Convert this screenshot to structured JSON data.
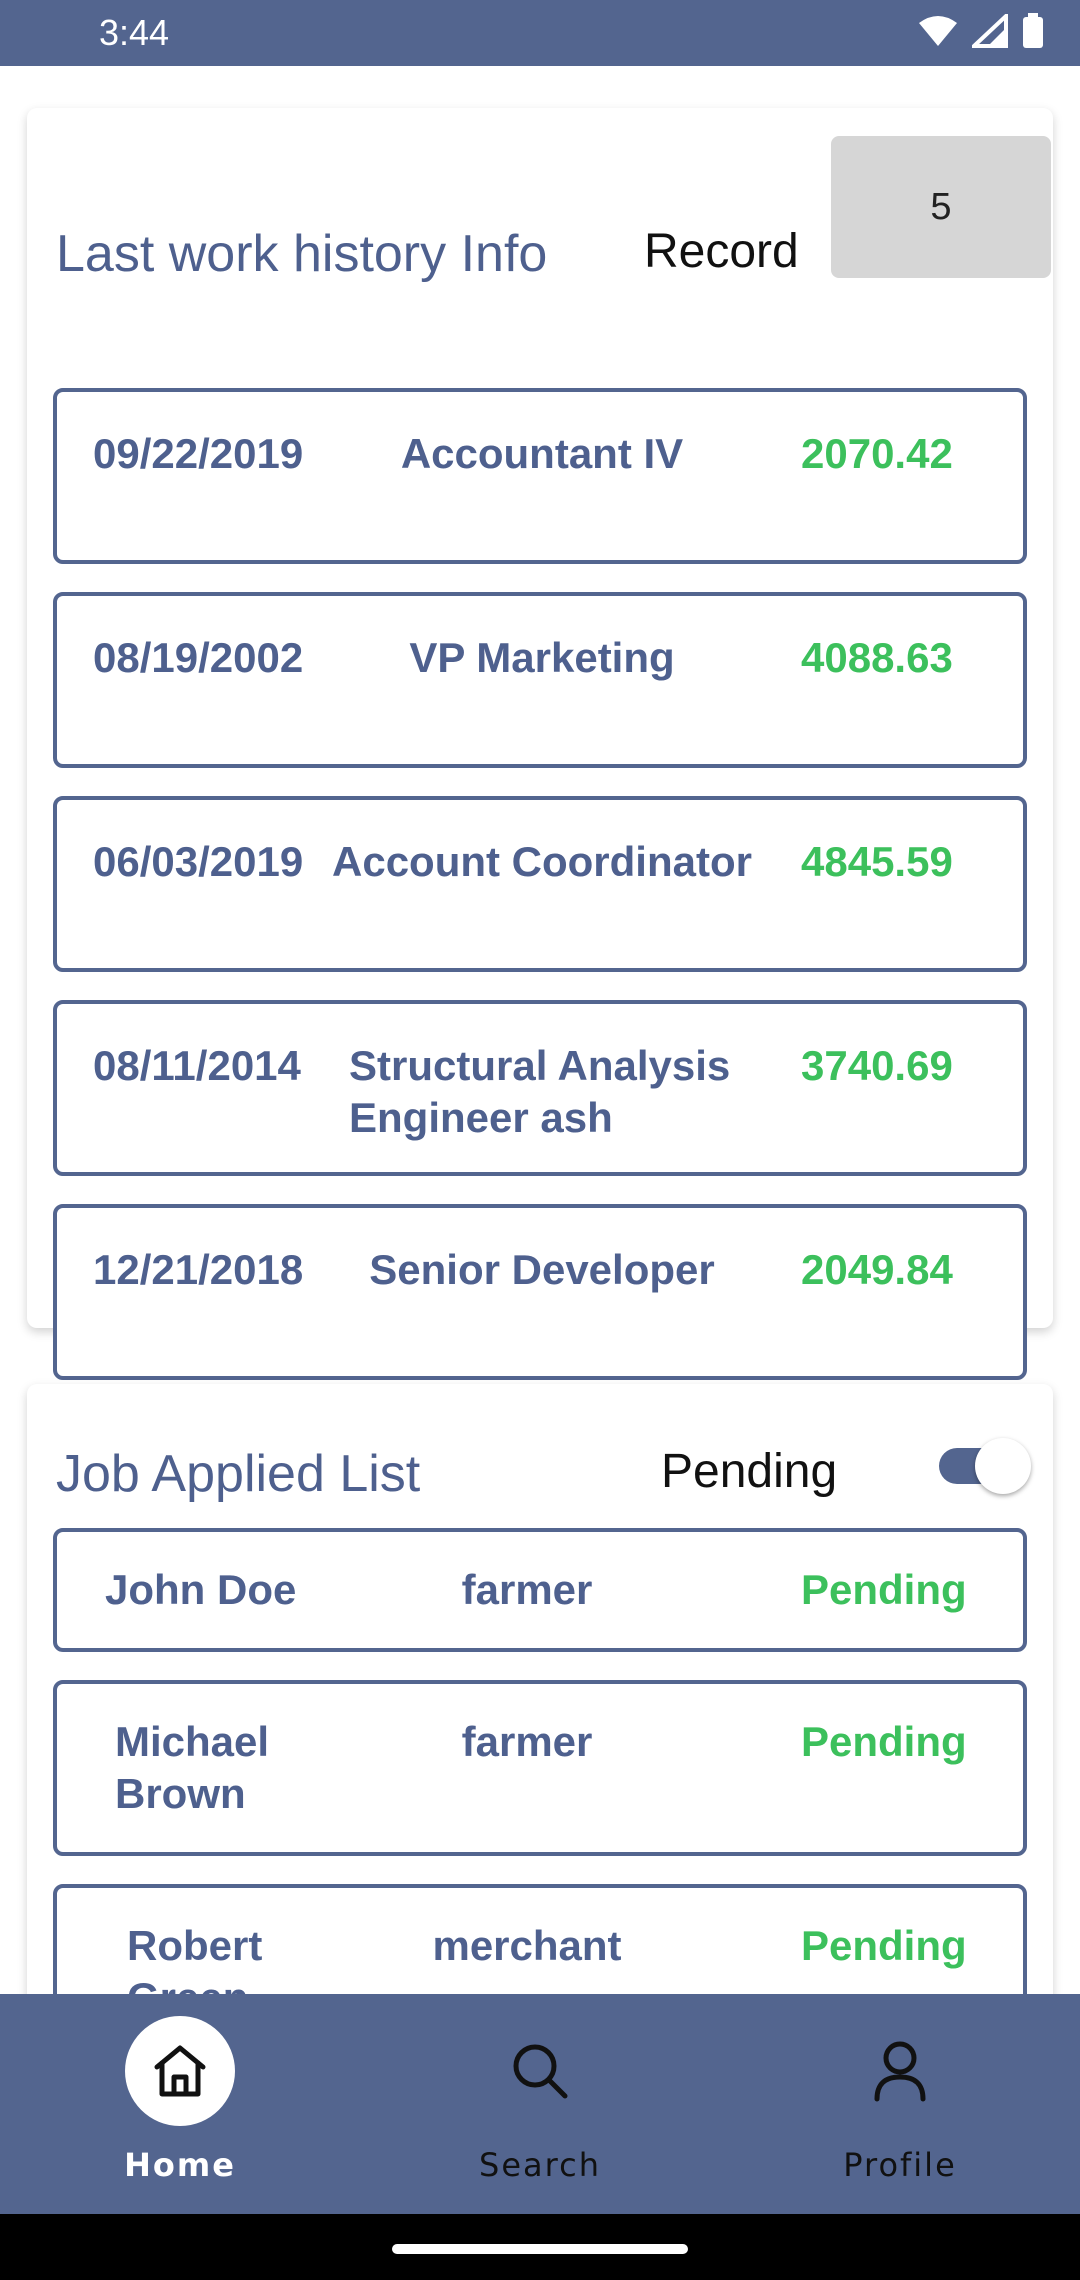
{
  "status_bar": {
    "time": "3:44",
    "icons": [
      "wifi-icon",
      "signal-icon",
      "battery-icon"
    ]
  },
  "work_history": {
    "title": "Last work history Info",
    "record_label": "Record",
    "record_value": "5",
    "rows": [
      {
        "date": "09/22/2019",
        "position": "Accountant IV",
        "amount": "2070.42"
      },
      {
        "date": "08/19/2002",
        "position": "VP Marketing",
        "amount": "4088.63"
      },
      {
        "date": "06/03/2019",
        "position": "Account Coordinator",
        "amount": "4845.59"
      },
      {
        "date": "08/11/2014",
        "position": "Structural Analysis Engineer ash",
        "amount": "3740.69"
      },
      {
        "date": "12/21/2018",
        "position": "Senior Developer",
        "amount": "2049.84"
      }
    ]
  },
  "job_applied": {
    "title": "Job Applied List",
    "filter_label": "Pending",
    "filter_on": true,
    "rows": [
      {
        "name": "John Doe",
        "job": "farmer",
        "status": "Pending"
      },
      {
        "name": "Michael Brown",
        "job": "farmer",
        "status": "Pending"
      },
      {
        "name": "Robert Green",
        "job": "merchant",
        "status": "Pending"
      }
    ]
  },
  "bottom_nav": {
    "items": [
      {
        "label": "Home",
        "icon": "home-icon",
        "active": true
      },
      {
        "label": "Search",
        "icon": "search-icon",
        "active": false
      },
      {
        "label": "Profile",
        "icon": "profile-icon",
        "active": false
      }
    ]
  },
  "colors": {
    "primary": "#53658f",
    "text_primary": "#4e608e",
    "accent_green": "#3cc05c",
    "record_box": "#d6d6d6"
  }
}
